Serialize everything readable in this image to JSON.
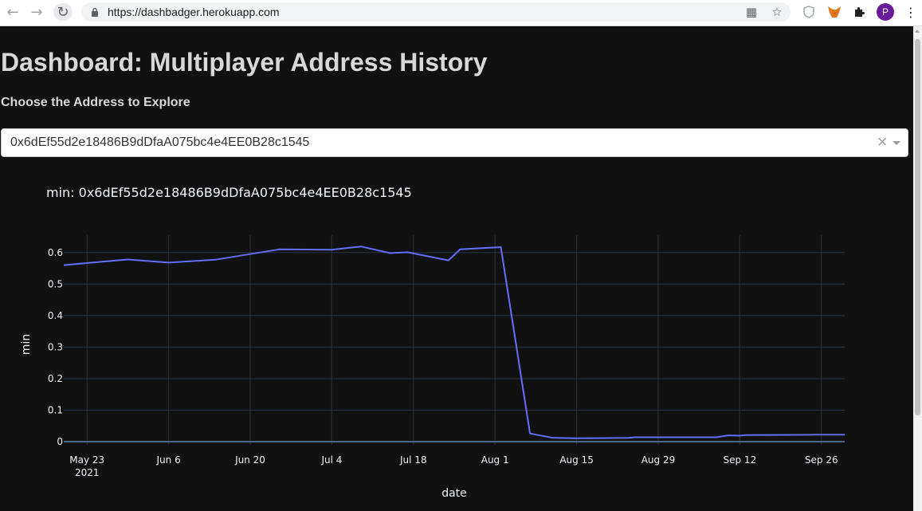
{
  "browser": {
    "url": "https://dashbadger.herokuapp.com",
    "avatar_letter": "P",
    "icons": [
      "back-arrow-icon",
      "forward-arrow-icon",
      "reload-icon",
      "lock-icon",
      "qr-code-icon",
      "star-icon",
      "shield-extension-icon",
      "metamask-fox-icon",
      "puzzle-extensions-icon",
      "kebab-menu-icon"
    ]
  },
  "page": {
    "title": "Dashboard: Multiplayer Address History",
    "choose_label": "Choose the Address to Explore",
    "selected_address": "0x6dEf55d2e18486B9dDfaA075bc4e4EE0B28c1545",
    "clear_symbol": "×"
  },
  "colors": {
    "background": "#111111",
    "line": "#636efa",
    "grid": "#283442",
    "text": "#f2f5fa"
  },
  "chart_data": {
    "type": "line",
    "title": "min: 0x6dEf55d2e18486B9dDfaA075bc4e4EE0B28c1545",
    "xlabel": "date",
    "ylabel": "min",
    "x_tick_labels": [
      {
        "date": "2021-05-23",
        "label": "May 23",
        "sublabel": "2021"
      },
      {
        "date": "2021-06-06",
        "label": "Jun 6"
      },
      {
        "date": "2021-06-20",
        "label": "Jun 20"
      },
      {
        "date": "2021-07-04",
        "label": "Jul 4"
      },
      {
        "date": "2021-07-18",
        "label": "Jul 18"
      },
      {
        "date": "2021-08-01",
        "label": "Aug 1"
      },
      {
        "date": "2021-08-15",
        "label": "Aug 15"
      },
      {
        "date": "2021-08-29",
        "label": "Aug 29"
      },
      {
        "date": "2021-09-12",
        "label": "Sep 12"
      },
      {
        "date": "2021-09-26",
        "label": "Sep 26"
      }
    ],
    "y_ticks": [
      0,
      0.1,
      0.2,
      0.3,
      0.4,
      0.5,
      0.6
    ],
    "y_tick_labels": [
      "0",
      "0.1",
      "0.2",
      "0.3",
      "0.4",
      "0.5",
      "0.6"
    ],
    "xlim": [
      "2021-05-19",
      "2021-09-30"
    ],
    "ylim": [
      -0.01,
      0.655
    ],
    "grid": true,
    "series": [
      {
        "x": [
          "2021-05-19",
          "2021-05-25",
          "2021-05-30",
          "2021-06-06",
          "2021-06-14",
          "2021-06-20",
          "2021-06-25",
          "2021-07-04",
          "2021-07-09",
          "2021-07-14",
          "2021-07-17",
          "2021-07-24",
          "2021-07-26",
          "2021-08-02",
          "2021-08-07",
          "2021-08-11",
          "2021-08-15",
          "2021-08-24",
          "2021-08-25",
          "2021-09-08",
          "2021-09-09",
          "2021-09-10",
          "2021-09-12",
          "2021-09-13",
          "2021-09-25",
          "2021-09-30"
        ],
        "y": [
          0.56,
          0.57,
          0.578,
          0.568,
          0.577,
          0.595,
          0.61,
          0.609,
          0.619,
          0.598,
          0.601,
          0.575,
          0.61,
          0.617,
          0.026,
          0.012,
          0.011,
          0.012,
          0.014,
          0.014,
          0.017,
          0.02,
          0.019,
          0.021,
          0.022,
          0.022
        ]
      }
    ]
  }
}
